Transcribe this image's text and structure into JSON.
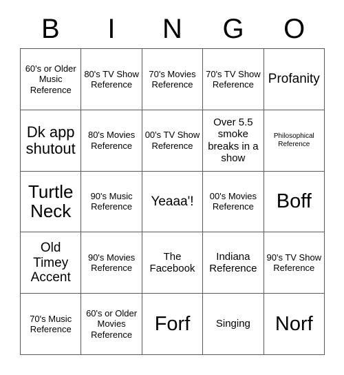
{
  "header": {
    "letters": [
      "B",
      "I",
      "N",
      "G",
      "O"
    ]
  },
  "grid": {
    "rows": 5,
    "columns": 5,
    "cells": [
      {
        "text": "60's or Older Music Reference",
        "size": "sm"
      },
      {
        "text": "80's TV Show Reference",
        "size": "sm"
      },
      {
        "text": "70's Movies Reference",
        "size": "sm"
      },
      {
        "text": "70's TV Show Reference",
        "size": "sm"
      },
      {
        "text": "Profanity",
        "size": "lg"
      },
      {
        "text": "Dk app shutout",
        "size": "xl"
      },
      {
        "text": "80's Movies Reference",
        "size": "sm"
      },
      {
        "text": "00's TV Show Reference",
        "size": "sm"
      },
      {
        "text": "Over 5.5 smoke breaks in a show",
        "size": "md"
      },
      {
        "text": "Philosophical Reference",
        "size": "xs"
      },
      {
        "text": "Turtle Neck",
        "size": "2xl"
      },
      {
        "text": "90's Music Reference",
        "size": "sm"
      },
      {
        "text": "Yeaaa'!",
        "size": "lg"
      },
      {
        "text": "00's Movies Reference",
        "size": "sm"
      },
      {
        "text": "Boff",
        "size": "3xl"
      },
      {
        "text": "Old Timey Accent",
        "size": "lg"
      },
      {
        "text": "90's Movies Reference",
        "size": "sm"
      },
      {
        "text": "The Facebook",
        "size": "md"
      },
      {
        "text": "Indiana Reference",
        "size": "md"
      },
      {
        "text": "90's TV Show Reference",
        "size": "sm"
      },
      {
        "text": "70's Music Reference",
        "size": "sm"
      },
      {
        "text": "60's or Older Movies Reference",
        "size": "sm"
      },
      {
        "text": "Forf",
        "size": "3xl"
      },
      {
        "text": "Singing",
        "size": "md"
      },
      {
        "text": "Norf",
        "size": "3xl"
      }
    ]
  },
  "colors": {
    "background": "#ffffff",
    "text": "#000000",
    "grid_line": "#575757"
  }
}
